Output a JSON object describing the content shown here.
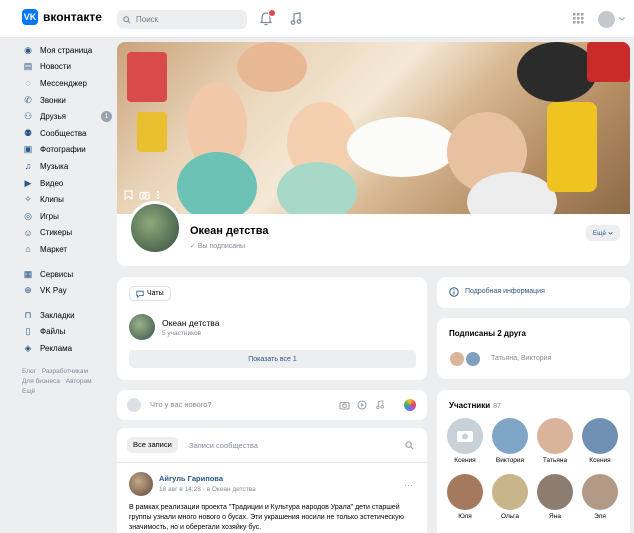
{
  "header": {
    "logo_letters": "VK",
    "logo_text": "вконтакте",
    "search_placeholder": "Поиск",
    "icons": [
      "bell-icon",
      "music-icon",
      "apps-icon",
      "chevron-down-icon"
    ]
  },
  "sidebar": {
    "items": [
      {
        "label": "Моя страница",
        "icon": "user-icon"
      },
      {
        "label": "Новости",
        "icon": "news-icon"
      },
      {
        "label": "Мессенджер",
        "icon": "chat-icon"
      },
      {
        "label": "Звонки",
        "icon": "phone-icon"
      },
      {
        "label": "Друзья",
        "icon": "friends-icon",
        "badge": "1"
      },
      {
        "label": "Сообщества",
        "icon": "community-icon"
      },
      {
        "label": "Фотографии",
        "icon": "photo-icon"
      },
      {
        "label": "Музыка",
        "icon": "music-icon"
      },
      {
        "label": "Видео",
        "icon": "video-icon"
      },
      {
        "label": "Клипы",
        "icon": "clips-icon"
      },
      {
        "label": "Игры",
        "icon": "games-icon"
      },
      {
        "label": "Стикеры",
        "icon": "stickers-icon"
      },
      {
        "label": "Маркет",
        "icon": "market-icon"
      }
    ],
    "items2": [
      {
        "label": "Сервисы",
        "icon": "services-icon"
      },
      {
        "label": "VK Pay",
        "icon": "pay-icon"
      }
    ],
    "items3": [
      {
        "label": "Закладки",
        "icon": "bookmark-icon"
      },
      {
        "label": "Файлы",
        "icon": "file-icon"
      },
      {
        "label": "Реклама",
        "icon": "ads-icon"
      }
    ],
    "footer": [
      "Блог",
      "Разработчикам",
      "Для бизнеса",
      "Авторам",
      "Ещё"
    ]
  },
  "profile": {
    "name": "Океан детства",
    "status": "Вы подписаны",
    "more_label": "Ещё"
  },
  "chats": {
    "chip_label": "Чаты",
    "chat_name": "Океан детства",
    "chat_sub": "5 участников",
    "show_all": "Показать все 1"
  },
  "new_post": {
    "placeholder": "Что у вас нового?"
  },
  "wall": {
    "tab_all": "Все записи",
    "tab_community": "Записи сообщества",
    "post_author": "Айгуль Гарипова",
    "post_date": "18 авг в 14:28 · в Океан детства",
    "post_text": "В рамках реализации проекта \"Традиции и Культура народов Урала\" дети старшей группы узнали много нового о бусах. Эти украшения носили не только эстетическую значимость, но и оберегали хозяйку бус."
  },
  "info": {
    "label": "Подробная информация"
  },
  "friends": {
    "title": "Подписаны 2 друга",
    "names": "Татьяна, Виктория"
  },
  "members": {
    "title": "Участники",
    "count": "87",
    "people": [
      {
        "name": "Ксения",
        "color": "#c8d0d8"
      },
      {
        "name": "Виктория",
        "color": "#7fa6c7"
      },
      {
        "name": "Татьяна",
        "color": "#d9b49a"
      },
      {
        "name": "Ксения",
        "color": "#6f8fb3"
      },
      {
        "name": "Юля",
        "color": "#a5795e"
      },
      {
        "name": "Ольга",
        "color": "#c9b58a"
      },
      {
        "name": "Яна",
        "color": "#8c7d70"
      },
      {
        "name": "Эля",
        "color": "#b39a86"
      }
    ]
  }
}
